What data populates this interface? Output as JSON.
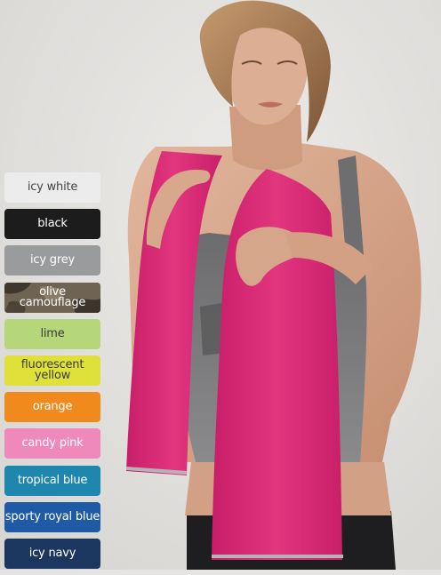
{
  "swatches": [
    {
      "label": "icy white",
      "bg": "#ececec",
      "fg": "#444444"
    },
    {
      "label": "black",
      "bg": "#1c1c1c",
      "fg": "#ffffff"
    },
    {
      "label": "icy grey",
      "bg": "#9a9b9d",
      "fg": "#ffffff"
    },
    {
      "label": "olive camouflage",
      "bg": "#6b6152",
      "fg": "#ffffff"
    },
    {
      "label": "lime",
      "bg": "#b5d779",
      "fg": "#3a3a3a"
    },
    {
      "label": "fluorescent\nyellow",
      "bg": "#e0e03a",
      "fg": "#3a3a3a"
    },
    {
      "label": "orange",
      "bg": "#f08a1c",
      "fg": "#ffffff"
    },
    {
      "label": "candy pink",
      "bg": "#ef88bb",
      "fg": "#ffffff"
    },
    {
      "label": "tropical blue",
      "bg": "#1f87ad",
      "fg": "#ffffff"
    },
    {
      "label": "sporty royal blue",
      "bg": "#1f5aa6",
      "fg": "#ffffff"
    },
    {
      "label": "icy navy",
      "bg": "#1b365f",
      "fg": "#ffffff"
    }
  ],
  "colors": {
    "background": "#e5e4e2",
    "towel": "#e0327e",
    "top": "#7b7b7d",
    "skin": "#d7a98e",
    "hair": "#a97b52"
  }
}
